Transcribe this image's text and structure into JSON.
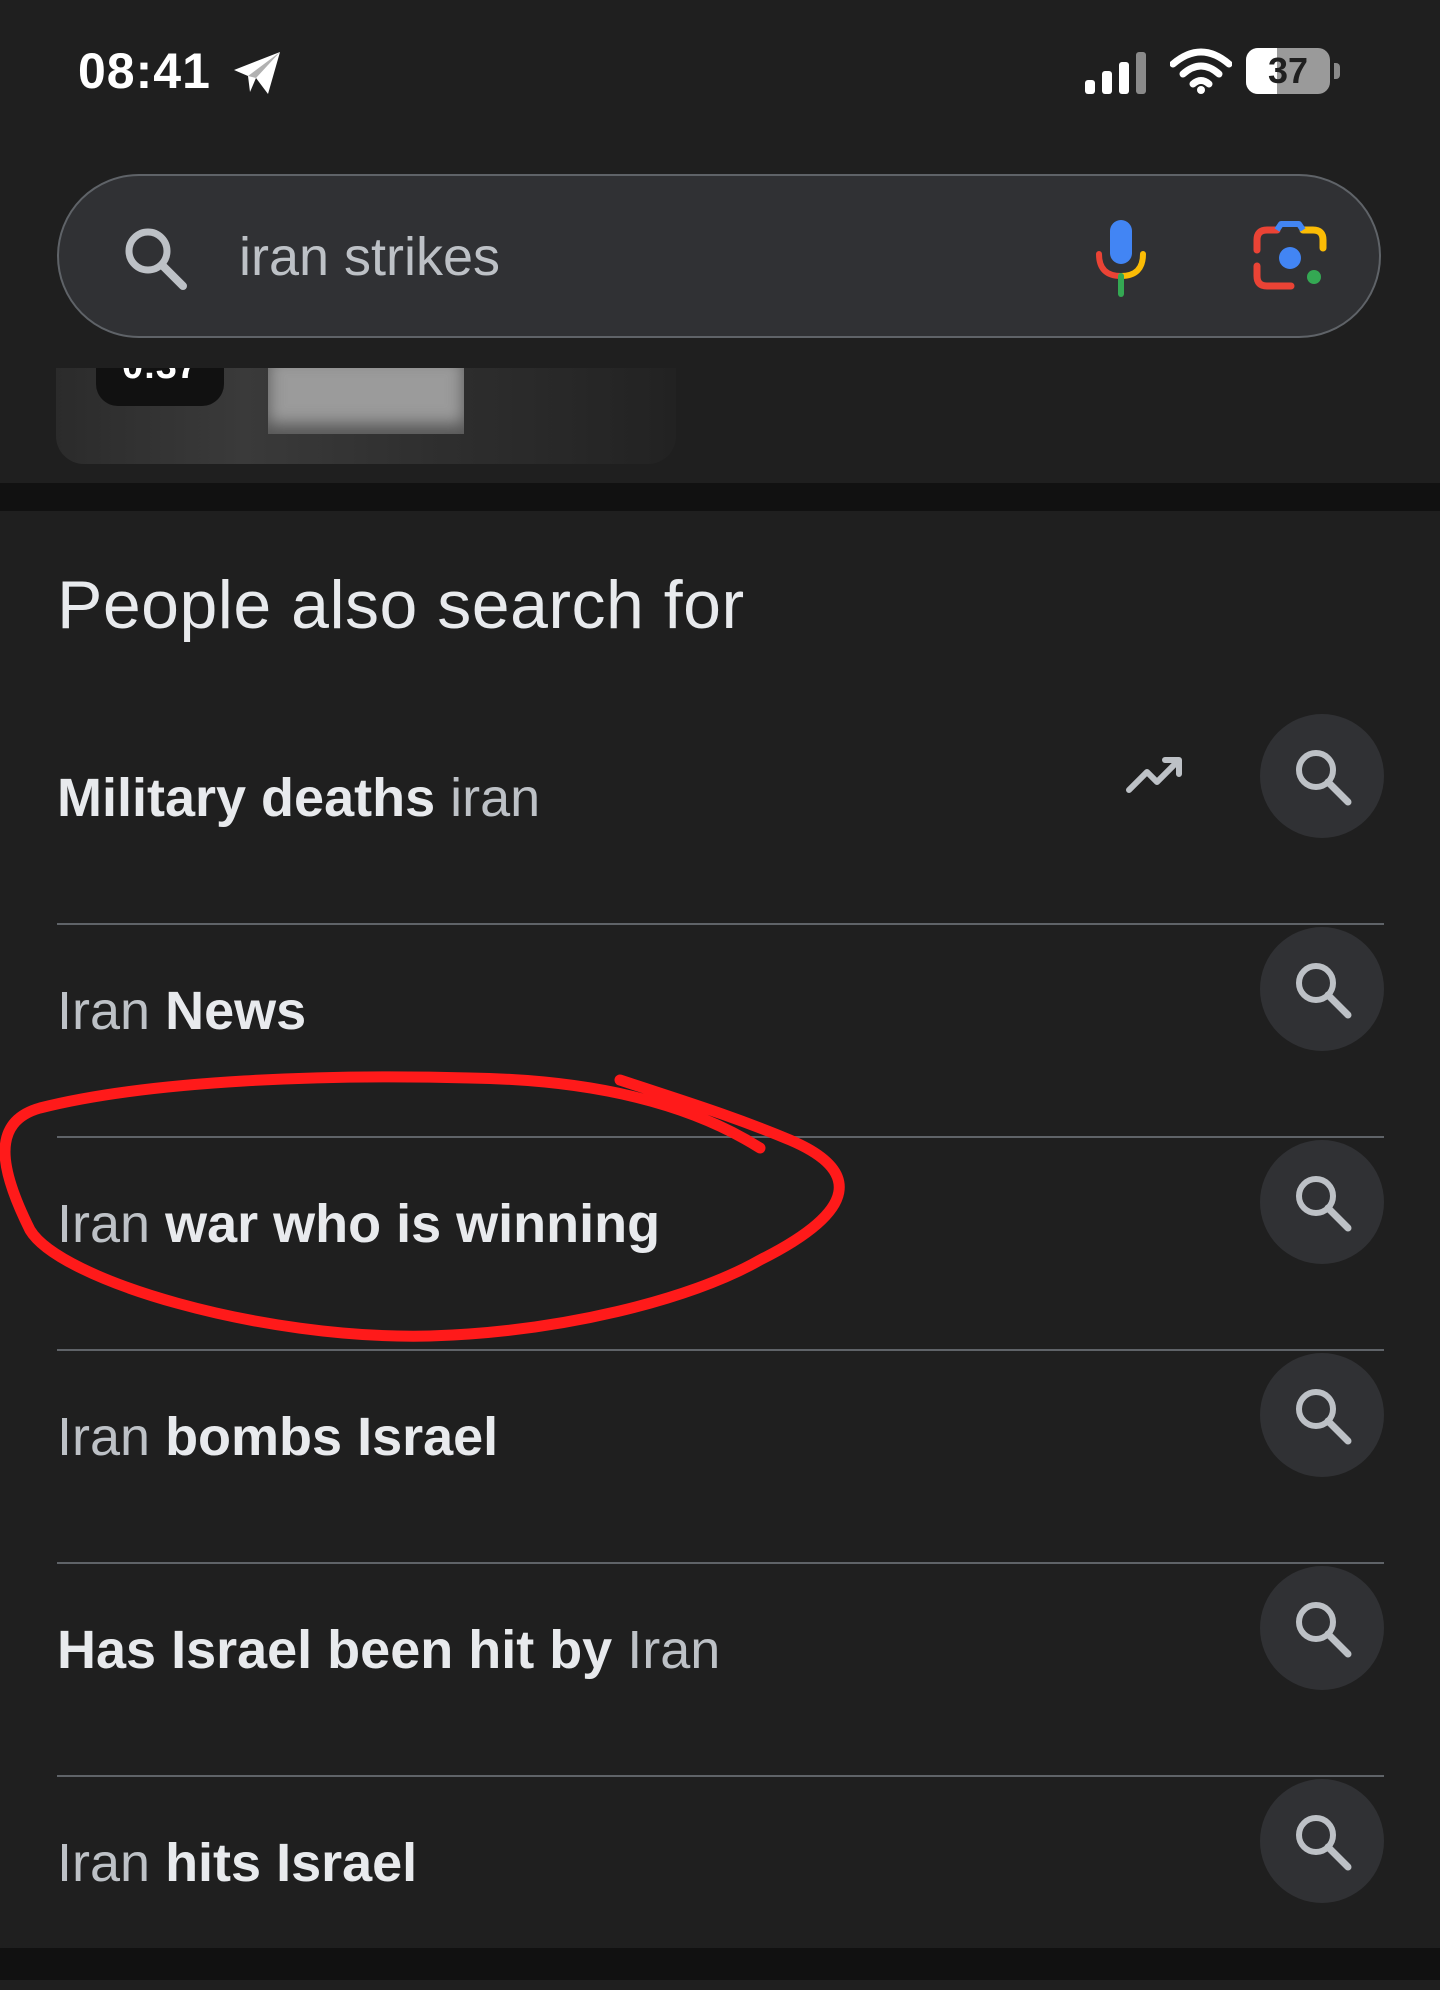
{
  "status_bar": {
    "time": "08:41",
    "battery_percent": 37,
    "battery_label": "37",
    "icons": [
      "telegram-icon",
      "signal-icon",
      "wifi-icon",
      "battery-icon"
    ]
  },
  "search": {
    "query": "iran strikes",
    "icons": [
      "search-icon",
      "mic-icon",
      "google-lens-icon"
    ]
  },
  "video": {
    "duration": "0:37"
  },
  "people_also_search": {
    "title": "People also search for",
    "items": [
      {
        "parts": [
          {
            "text": "Military deaths",
            "bold": true
          },
          {
            "text": " iran",
            "bold": false
          }
        ],
        "trending": true
      },
      {
        "parts": [
          {
            "text": "Iran",
            "bold": false
          },
          {
            "text": " News",
            "bold": true
          }
        ],
        "trending": false
      },
      {
        "parts": [
          {
            "text": "Iran",
            "bold": false
          },
          {
            "text": " war who is winning",
            "bold": true
          }
        ],
        "trending": false
      },
      {
        "parts": [
          {
            "text": "Iran",
            "bold": false
          },
          {
            "text": " bombs Israel",
            "bold": true
          }
        ],
        "trending": false
      },
      {
        "parts": [
          {
            "text": "Has Israel been hit by",
            "bold": true
          },
          {
            "text": " Iran",
            "bold": false
          }
        ],
        "trending": false
      },
      {
        "parts": [
          {
            "text": "Iran",
            "bold": false
          },
          {
            "text": " hits Israel",
            "bold": true
          }
        ],
        "trending": false
      }
    ]
  },
  "colors": {
    "background": "#1f1f1f",
    "surface": "#303134",
    "divider": "#5f6368",
    "annotation": "#ff1a1a"
  }
}
